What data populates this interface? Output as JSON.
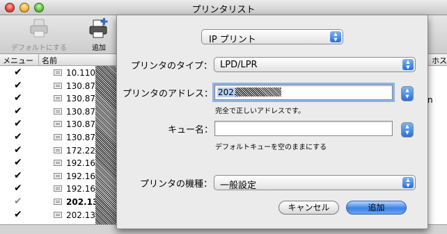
{
  "window": {
    "title": "プリンタリスト"
  },
  "toolbar": {
    "default_label": "デフォルトにする",
    "add_label": "追加"
  },
  "columns": {
    "menu": "メニュー",
    "name": "名前",
    "host": "ホス"
  },
  "rows": [
    {
      "name": "10.110",
      "checked": true,
      "bold": false
    },
    {
      "name": "130.87",
      "checked": true,
      "bold": false
    },
    {
      "name": "130.87",
      "checked": true,
      "bold": false
    },
    {
      "name": "130.87",
      "checked": true,
      "bold": false
    },
    {
      "name": "130.87",
      "checked": true,
      "bold": false
    },
    {
      "name": "130.87",
      "checked": true,
      "bold": false
    },
    {
      "name": "172.22",
      "checked": true,
      "bold": false
    },
    {
      "name": "192.16",
      "checked": true,
      "bold": false
    },
    {
      "name": "192.16",
      "checked": true,
      "bold": false
    },
    {
      "name": "192.16",
      "checked": true,
      "bold": false
    },
    {
      "name": "202.13",
      "checked": true,
      "bold": true,
      "dim": true
    },
    {
      "name": "202.13",
      "checked": true,
      "bold": false
    }
  ],
  "right_strip_text": "n",
  "sheet": {
    "connection_popup": "IP プリント",
    "type_label": "プリンタのタイプ：",
    "type_value": "LPD/LPR",
    "address_label": "プリンタのアドレス：",
    "address_value": "202.",
    "address_hint": "完全で正しいアドレスです。",
    "queue_label": "キュー名：",
    "queue_value": "",
    "queue_hint": "デフォルトキューを空のままにする",
    "model_label": "プリンタの機種：",
    "model_value": "一般設定",
    "cancel_label": "キャンセル",
    "add_label": "追加"
  }
}
